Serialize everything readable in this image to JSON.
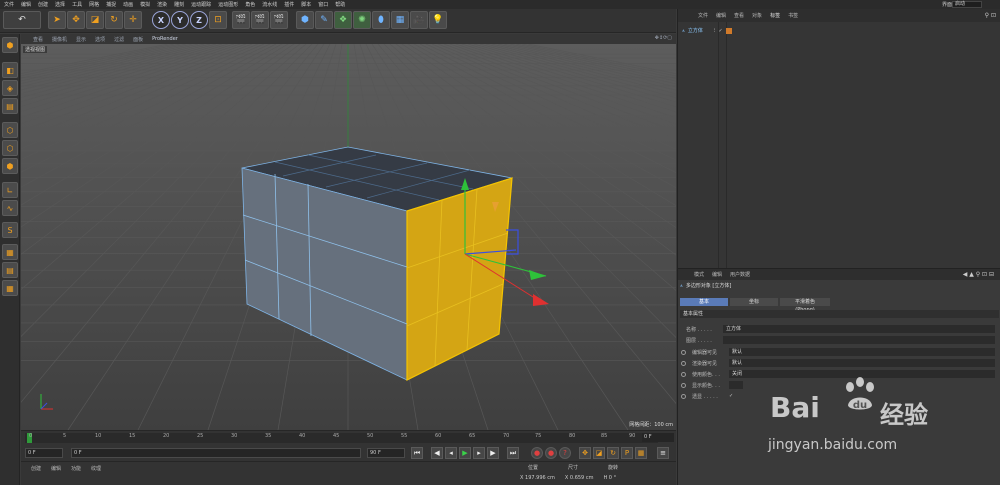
{
  "menubar": {
    "items": [
      "文件",
      "编辑",
      "创建",
      "选择",
      "工具",
      "网格",
      "捕捉",
      "动画",
      "模拟",
      "渲染",
      "雕刻",
      "运动跟踪",
      "运动图形",
      "角色",
      "流水线",
      "插件",
      "脚本",
      "窗口",
      "帮助"
    ],
    "layout_label": "界面",
    "layout_value": "启动"
  },
  "toolbar": {
    "axis_x": "X",
    "axis_y": "Y",
    "axis_z": "Z"
  },
  "viewport": {
    "menu": [
      "查看",
      "摄像机",
      "显示",
      "选项",
      "过滤",
      "面板"
    ],
    "prorender": "ProRender",
    "view_label": "透视视图",
    "grid_spacing": "网格间距：100 cm"
  },
  "timeline": {
    "ticks": [
      "0",
      "5",
      "10",
      "15",
      "20",
      "25",
      "30",
      "35",
      "40",
      "45",
      "50",
      "55",
      "60",
      "65",
      "70",
      "75",
      "80",
      "85",
      "90"
    ],
    "end_frame": "0 F"
  },
  "transport": {
    "start": "0 F",
    "current": "0 F",
    "end": "90 F",
    "end2": "90 F"
  },
  "bottom": {
    "tabs": [
      "创建",
      "编辑",
      "功能",
      "纹理"
    ],
    "coord_headers": [
      "位置",
      "尺寸",
      "旋转"
    ],
    "coord_values": [
      "X 197.996 cm",
      "X 0.659 cm",
      "H 0 °"
    ]
  },
  "object_manager": {
    "menu": [
      "文件",
      "编辑",
      "查看",
      "对象",
      "标签",
      "书签"
    ],
    "active_menu": "标签",
    "object_name": "立方体"
  },
  "attribute_manager": {
    "menu": [
      "模式",
      "编辑",
      "用户数据"
    ],
    "title": "多边形对象 [立方体]",
    "tabs": [
      "基本",
      "坐标",
      "平滑着色(Phong)"
    ],
    "section": "基本属性",
    "fields": [
      {
        "label": "名称 . . . . .",
        "value": "立方体"
      },
      {
        "label": "图层 . . . . .",
        "value": ""
      },
      {
        "label": "编辑器可见",
        "value": "默认"
      },
      {
        "label": "渲染器可见",
        "value": "默认"
      },
      {
        "label": "使用颜色. . .",
        "value": "关闭"
      },
      {
        "label": "显示颜色. . .",
        "value": ""
      },
      {
        "label": "透显 . . . . .",
        "value": ""
      }
    ]
  },
  "watermark": {
    "bai": "Bai",
    "du": "du",
    "jingyan": "经验",
    "url": "jingyan.baidu.com"
  },
  "colors": {
    "selection": "#f0c020",
    "accent_blue": "#5a7bb8",
    "viewport_bg": "#4a4a4a"
  }
}
